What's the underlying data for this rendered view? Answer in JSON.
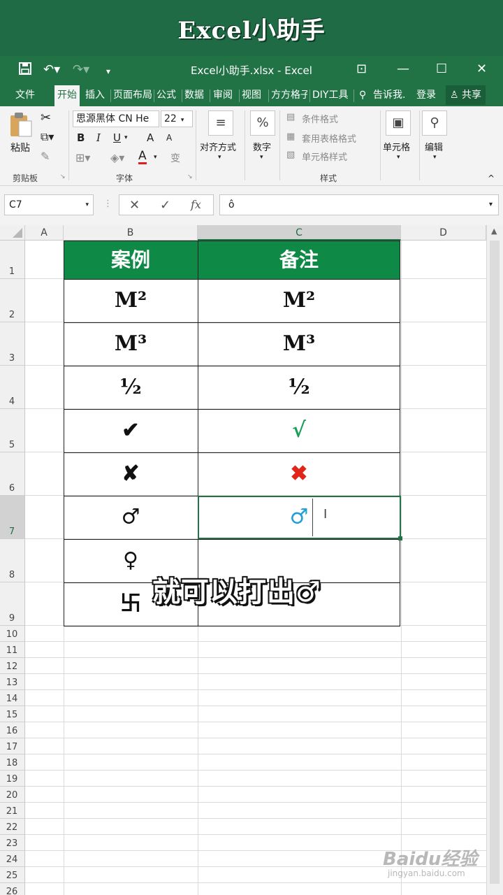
{
  "banner": {
    "title": "Excel小助手"
  },
  "titlebar": {
    "filename": "Excel小助手.xlsx - Excel",
    "save_icon": "save-icon",
    "undo_icon": "undo-icon",
    "redo_icon": "redo-icon",
    "minimize": "—",
    "maximize": "☐",
    "close": "✕",
    "ribbon_display": "⊡"
  },
  "tabs": {
    "items": [
      "文件",
      "开始",
      "插入",
      "页面布局",
      "公式",
      "数据",
      "审阅",
      "视图",
      "方方格子",
      "DIY工具"
    ],
    "active": "开始",
    "tell_me": "告诉我.",
    "login": "登录",
    "share": "共享"
  },
  "ribbon": {
    "clipboard": {
      "paste": "粘贴",
      "label": "剪贴板"
    },
    "font": {
      "name": "思源黑体 CN He",
      "size": "22",
      "bold": "B",
      "italic": "I",
      "underline": "U",
      "grow": "A",
      "shrink": "A",
      "color": "A",
      "phonetic": "变",
      "label": "字体"
    },
    "alignment": {
      "label": "对齐方式"
    },
    "number": {
      "label": "数字",
      "symbol": "%"
    },
    "styles": {
      "conditional": "条件格式",
      "table": "套用表格格式",
      "cell": "单元格样式",
      "label": "样式"
    },
    "cells": {
      "label": "单元格"
    },
    "editing": {
      "label": "编辑"
    }
  },
  "formula_bar": {
    "name_box": "C7",
    "cancel": "✕",
    "enter": "✓",
    "fx": "fx",
    "value": "ô"
  },
  "columns": [
    "A",
    "B",
    "C",
    "D"
  ],
  "selected_column": "C",
  "selected_row": "7",
  "rows": [
    "1",
    "2",
    "3",
    "4",
    "5",
    "6",
    "7",
    "8",
    "9",
    "10",
    "11",
    "12",
    "13",
    "14",
    "15",
    "16",
    "17",
    "18",
    "19",
    "20",
    "21",
    "22",
    "23",
    "24",
    "25",
    "26"
  ],
  "table": {
    "headers": [
      "案例",
      "备注"
    ],
    "example": [
      "M²",
      "M³",
      "½",
      "✔",
      "✘",
      "♂",
      "♀",
      "卐"
    ],
    "note": [
      "M²",
      "M³",
      "½",
      "√",
      "✖",
      "♂",
      "",
      ""
    ],
    "note_colors": [
      "#111111",
      "#111111",
      "#111111",
      "#1a9e5a",
      "#e0251b",
      "#1f9fd8",
      "#111111",
      "#111111"
    ],
    "header_color": "#0f8a46"
  },
  "caption": "就可以打出♂",
  "watermark": {
    "brand": "Baidu经验",
    "url": "jingyan.baidu.com"
  }
}
